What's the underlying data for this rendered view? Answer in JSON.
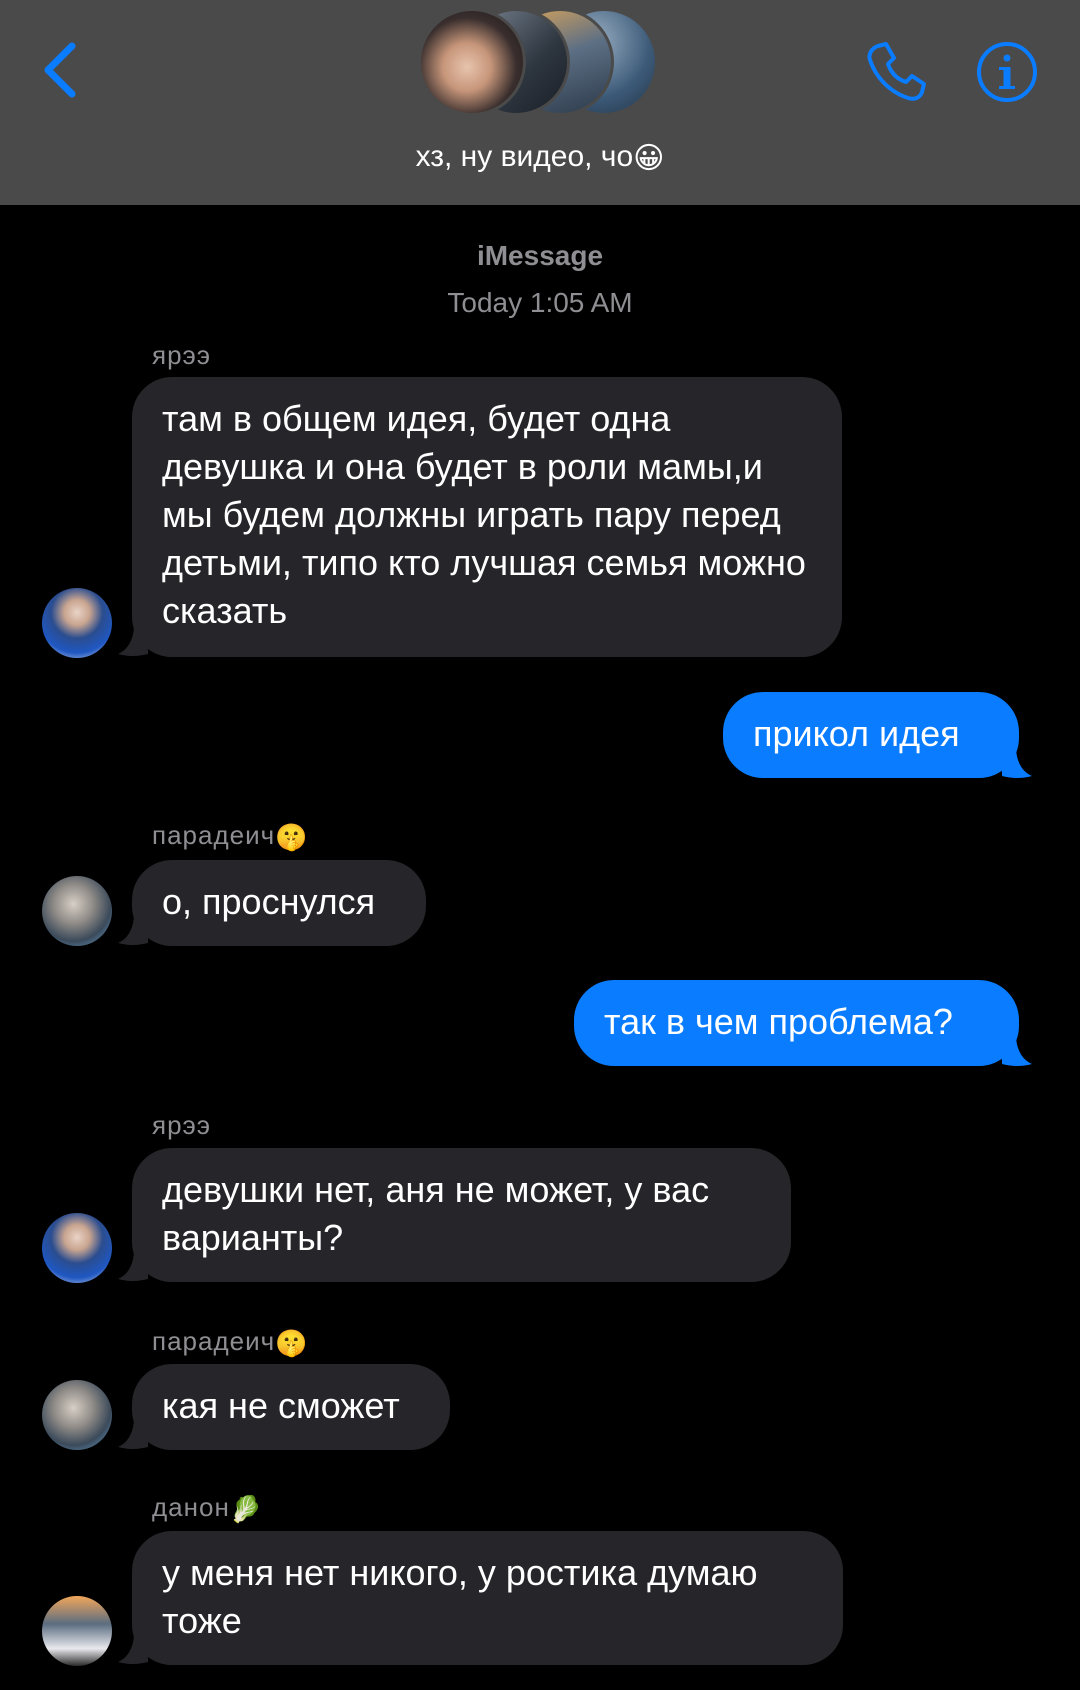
{
  "header": {
    "group_title": "хз, ну видео, чо",
    "title_emoji": "😀"
  },
  "meta": {
    "service": "iMessage",
    "timestamp": "Today 1:05 AM"
  },
  "messages": [
    {
      "sender": "ярээ",
      "sender_emoji": "",
      "text": "там в общем идея, будет одна девушка и она будет в роли мамы,и мы будем должны играть пару перед детьми, типо кто лучшая семья можно сказать",
      "direction": "incoming"
    },
    {
      "text": "прикол идея",
      "direction": "outgoing"
    },
    {
      "sender": "парадеич",
      "sender_emoji": "🤫",
      "text": "о, проснулся",
      "direction": "incoming"
    },
    {
      "text": "так в чем проблема?",
      "direction": "outgoing"
    },
    {
      "sender": "ярээ",
      "sender_emoji": "",
      "text": "девушки нет, аня не может, у вас варианты?",
      "direction": "incoming"
    },
    {
      "sender": "парадеич",
      "sender_emoji": "🤫",
      "text": "кая не сможет",
      "direction": "incoming"
    },
    {
      "sender": "данон",
      "sender_emoji": "🥬",
      "text": "у меня нет никого, у ростика думаю тоже",
      "direction": "incoming"
    }
  ],
  "colors": {
    "header_bg": "#4a4a4a",
    "accent": "#0a7cff",
    "incoming_bubble": "#26252a",
    "meta_text": "#8e8e93"
  },
  "icons": [
    "chevron-left-icon",
    "phone-icon",
    "info-icon"
  ]
}
